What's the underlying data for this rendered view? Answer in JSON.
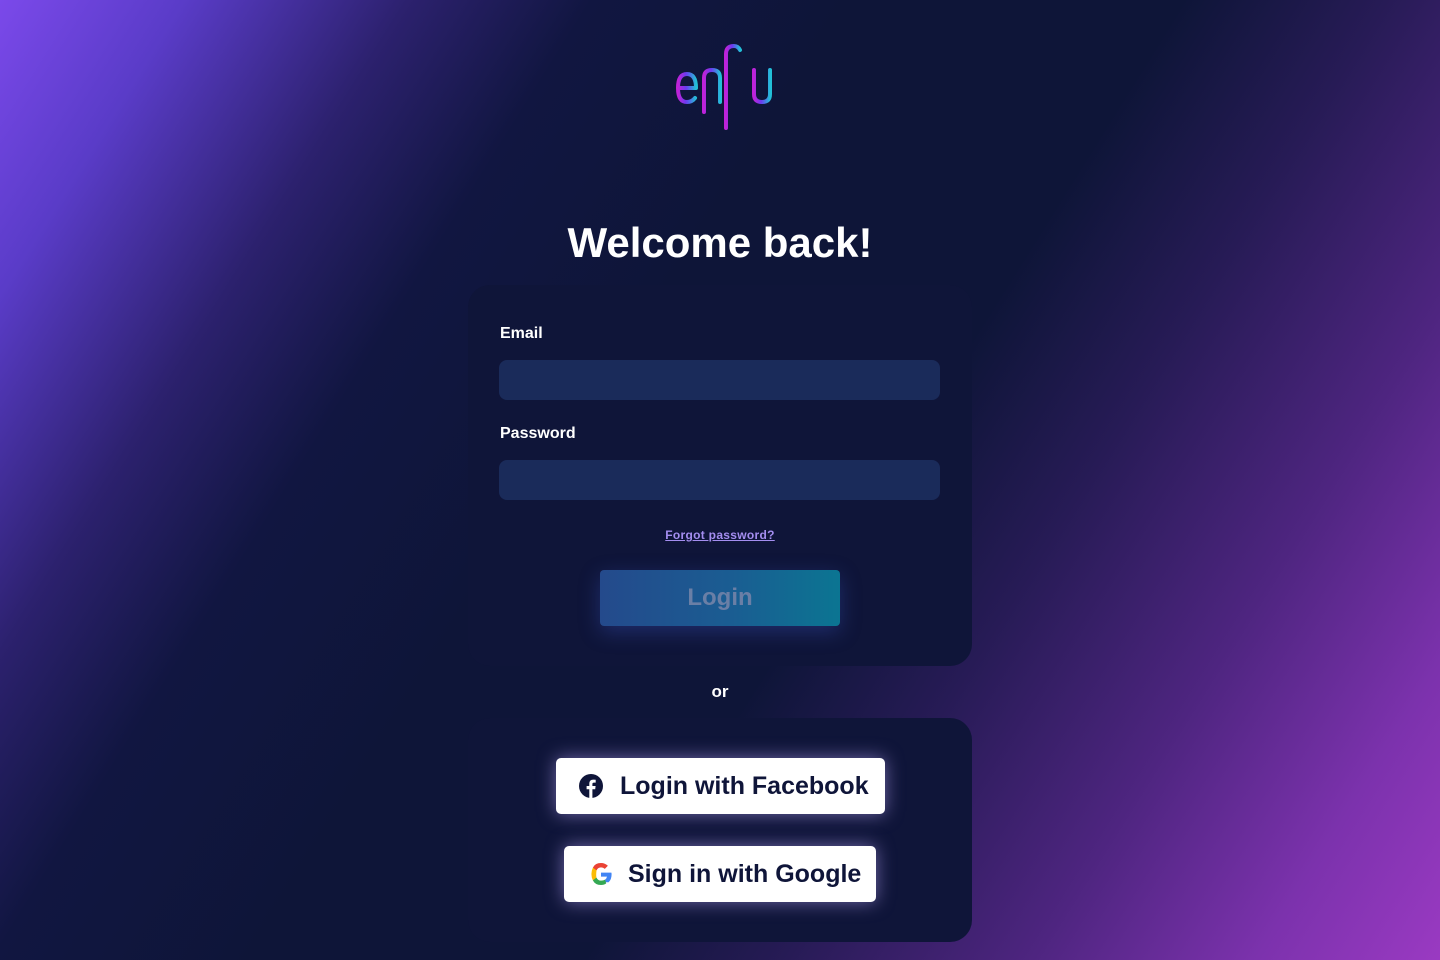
{
  "brand": {
    "logo_text": "enflu",
    "logo_icon": "soundwave-logo"
  },
  "heading": "Welcome back!",
  "form": {
    "email_label": "Email",
    "email_value": "",
    "password_label": "Password",
    "password_value": "",
    "forgot_link": "Forgot password?",
    "login_button": "Login"
  },
  "divider_text": "or",
  "social": {
    "facebook_label": "Login with Facebook",
    "facebook_icon": "facebook-icon",
    "google_label": "Sign in with Google",
    "google_icon": "google-icon"
  },
  "colors": {
    "panel": "#0f1539",
    "input_bg": "#1a2b5a",
    "link": "#a48ef0",
    "background_accent_left": "#7b49ea",
    "background_accent_right": "#9a3ac2"
  }
}
